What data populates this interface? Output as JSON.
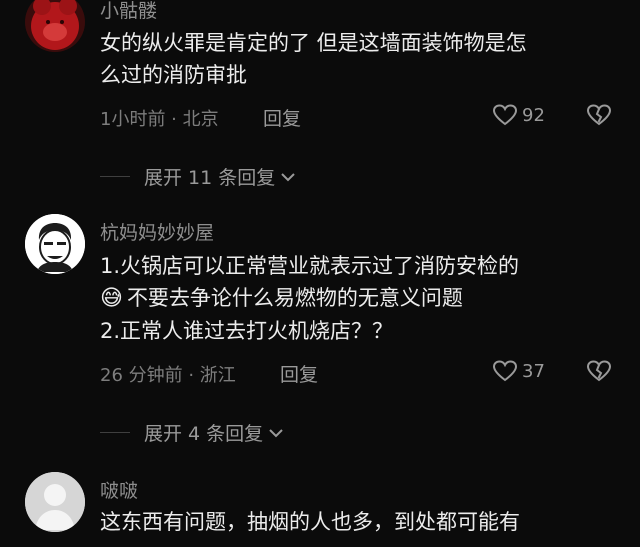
{
  "comments": [
    {
      "username": "小骷髅",
      "lines": [
        "女的纵火罪是肯定的了 但是这墙面装饰物是怎",
        "么过的消防审批"
      ],
      "meta": "1小时前 · 北京",
      "reply_label": "回复",
      "likes": "92",
      "expand_label": "展开 11 条回复"
    },
    {
      "username": "杭妈妈妙妙屋",
      "lines": [
        "1.火锅店可以正常营业就表示过了消防安检的",
        "不要去争论什么易燃物的无意义问题",
        "2.正常人谁过去打火机烧店？？"
      ],
      "emoji": "😅",
      "meta": "26 分钟前 · 浙江",
      "reply_label": "回复",
      "likes": "37",
      "expand_label": "展开 4 条回复"
    },
    {
      "username": "啵啵",
      "lines": [
        "这东西有问题，抽烟的人也多，到处都可能有"
      ]
    }
  ],
  "icons": {
    "like": "heart-outline-icon",
    "dislike": "broken-heart-icon",
    "expand": "chevron-down-icon"
  }
}
